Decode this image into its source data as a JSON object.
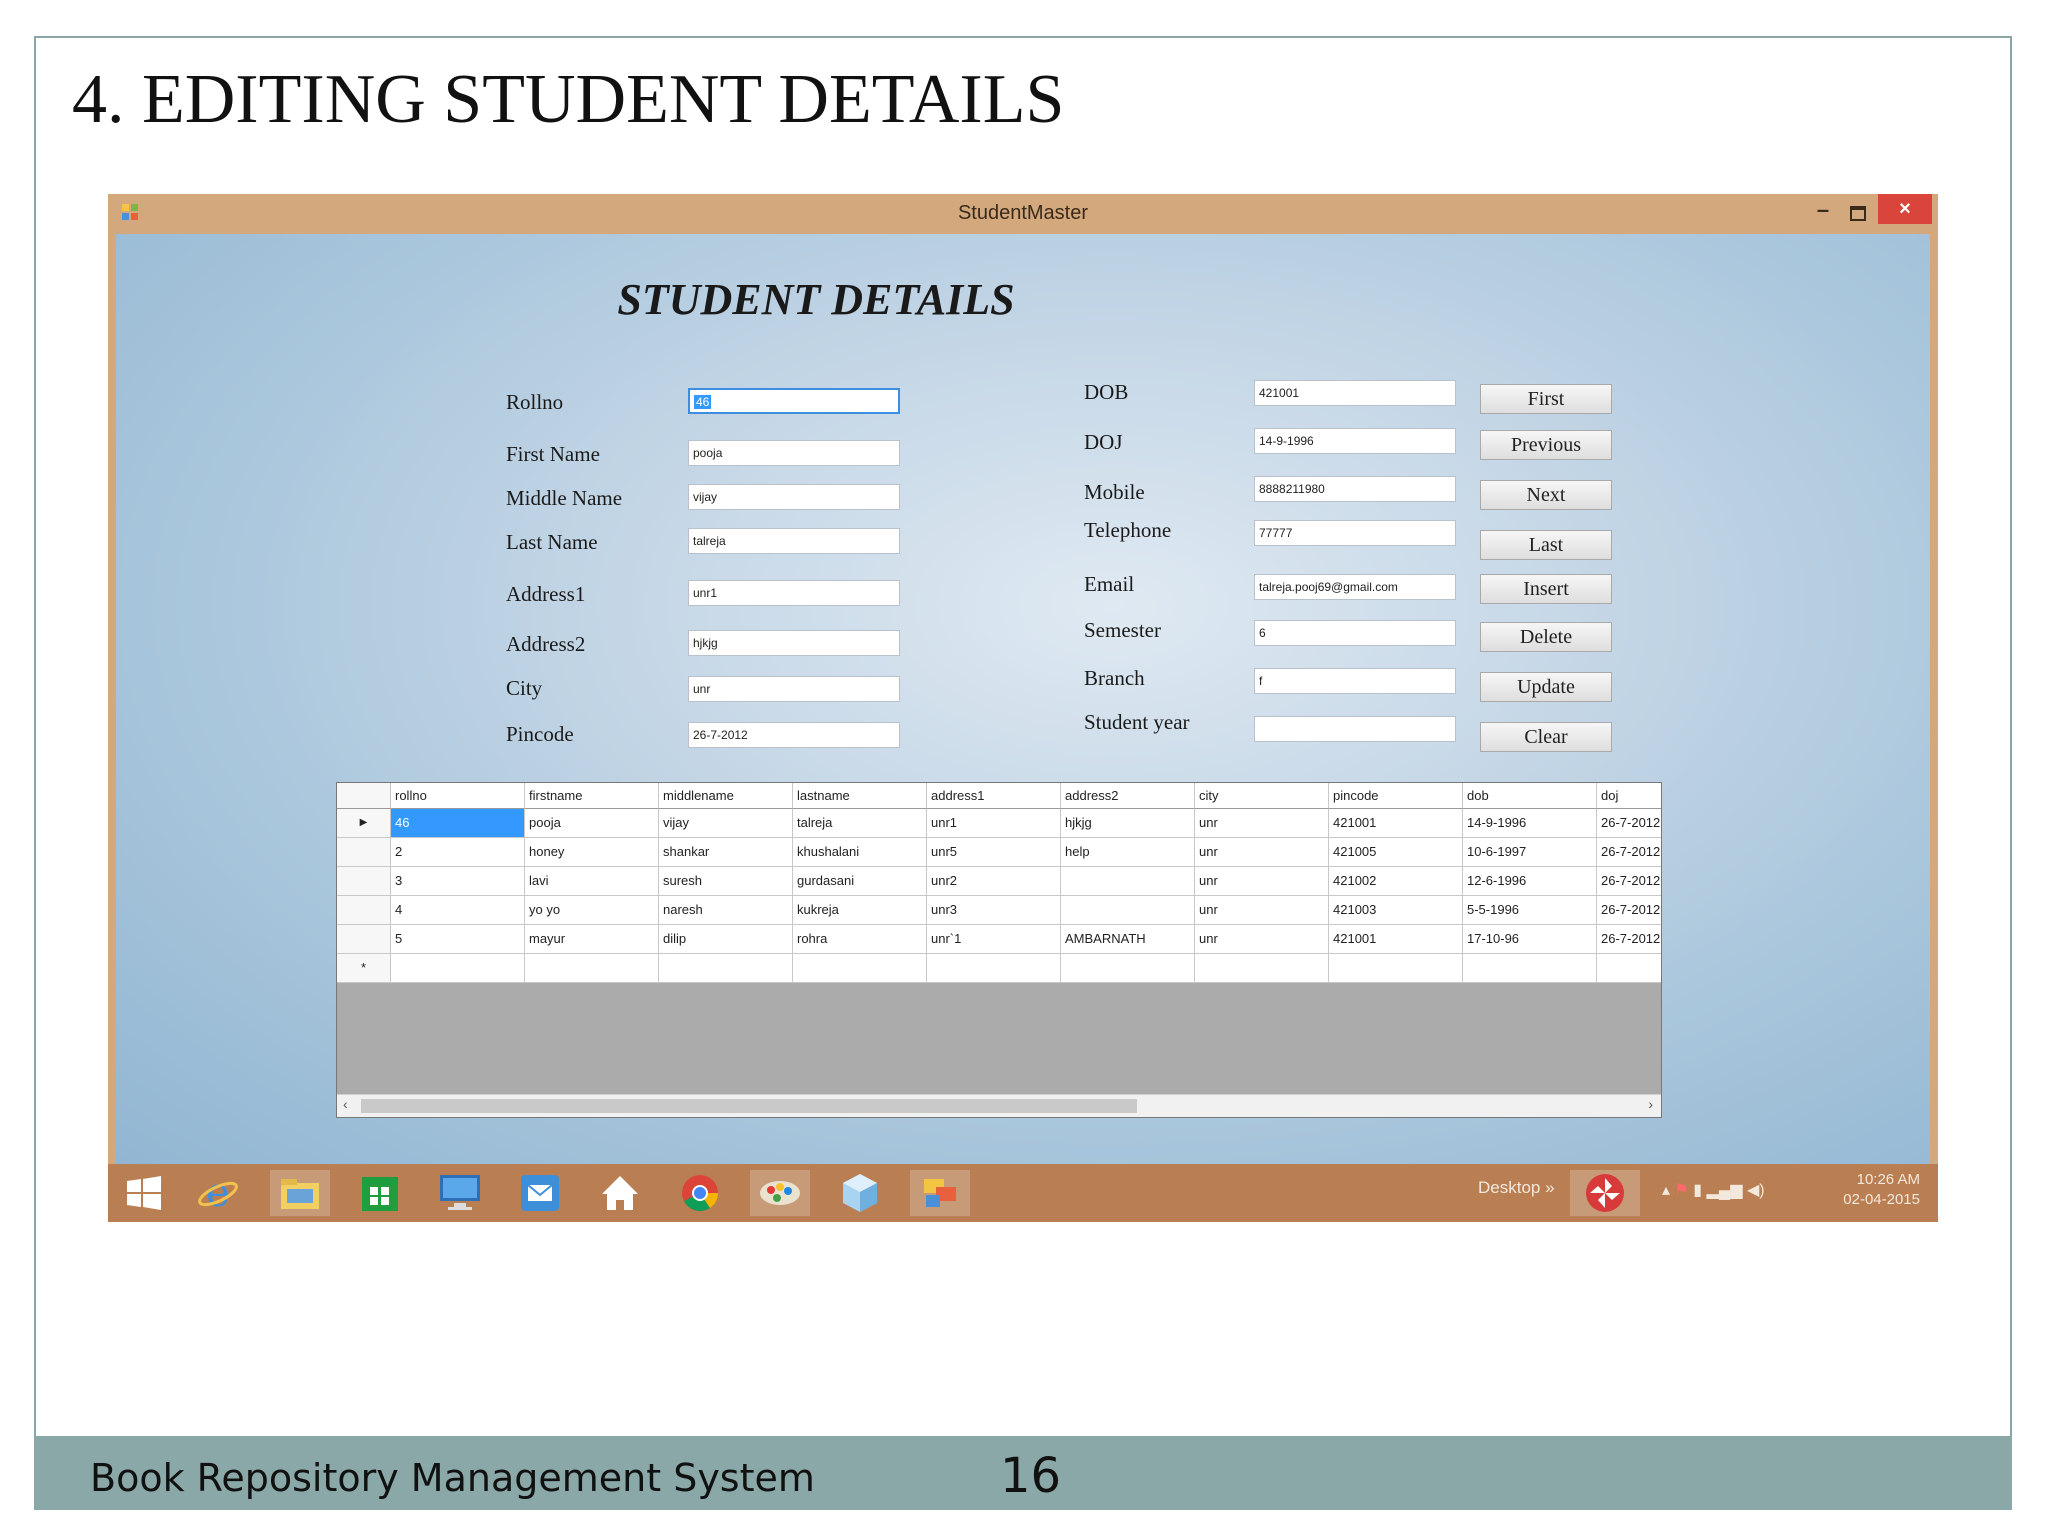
{
  "slide": {
    "title": "4. EDITING STUDENT DETAILS",
    "footer_text": "Book Repository Management System",
    "page_number": "16"
  },
  "window": {
    "title": "StudentMaster",
    "close_glyph": "×"
  },
  "form": {
    "heading": "STUDENT DETAILS",
    "left_fields": [
      {
        "label": "Rollno",
        "value": "46"
      },
      {
        "label": "First Name",
        "value": "pooja"
      },
      {
        "label": "Middle Name",
        "value": "vijay"
      },
      {
        "label": "Last Name",
        "value": "talreja"
      },
      {
        "label": "Address1",
        "value": "unr1"
      },
      {
        "label": "Address2",
        "value": "hjkjg"
      },
      {
        "label": "City",
        "value": "unr"
      },
      {
        "label": "Pincode",
        "value": "26-7-2012"
      }
    ],
    "right_fields": [
      {
        "label": "DOB",
        "value": "421001"
      },
      {
        "label": "DOJ",
        "value": "14-9-1996"
      },
      {
        "label": "Mobile",
        "value": "8888211980"
      },
      {
        "label": "Telephone",
        "value": "77777"
      },
      {
        "label": "Email",
        "value": "talreja.pooj69@gmail.com"
      },
      {
        "label": "Semester",
        "value": "6"
      },
      {
        "label": "Branch",
        "value": "f"
      },
      {
        "label": "Student year",
        "value": ""
      }
    ],
    "buttons": [
      "First",
      "Previous",
      "Next",
      "Last",
      "Insert",
      "Delete",
      "Update",
      "Clear"
    ]
  },
  "grid": {
    "columns": [
      "rollno",
      "firstname",
      "middlename",
      "lastname",
      "address1",
      "address2",
      "city",
      "pincode",
      "dob",
      "doj"
    ],
    "rows": [
      [
        "46",
        "pooja",
        "vijay",
        "talreja",
        "unr1",
        "hjkjg",
        "unr",
        "421001",
        "14-9-1996",
        "26-7-2012"
      ],
      [
        "2",
        "honey",
        "shankar",
        "khushalani",
        "unr5",
        "help",
        "unr",
        "421005",
        "10-6-1997",
        "26-7-2012"
      ],
      [
        "3",
        "lavi",
        "suresh",
        "gurdasani",
        "unr2",
        "",
        "unr",
        "421002",
        "12-6-1996",
        "26-7-2012"
      ],
      [
        "4",
        "yo yo",
        "naresh",
        "kukreja",
        "unr3",
        "",
        "unr",
        "421003",
        "5-5-1996",
        "26-7-2012"
      ],
      [
        "5",
        "mayur",
        "dilip",
        "rohra",
        "unr`1",
        "AMBARNATH",
        "unr",
        "421001",
        "17-10-96",
        "26-7-2012"
      ]
    ],
    "current_row_marker": "▶",
    "new_row_marker": "*"
  },
  "taskbar": {
    "desktop_label": "Desktop",
    "chevron": "»",
    "time": "10:26 AM",
    "date": "02-04-2015",
    "icons": [
      "windows-start-icon",
      "internet-explorer-icon",
      "file-explorer-icon",
      "store-icon",
      "desktop-computer-icon",
      "mail-icon",
      "home-icon",
      "chrome-icon",
      "paint-icon",
      "cube-icon",
      "office-app-icon",
      "pinwheel-app-icon"
    ]
  }
}
